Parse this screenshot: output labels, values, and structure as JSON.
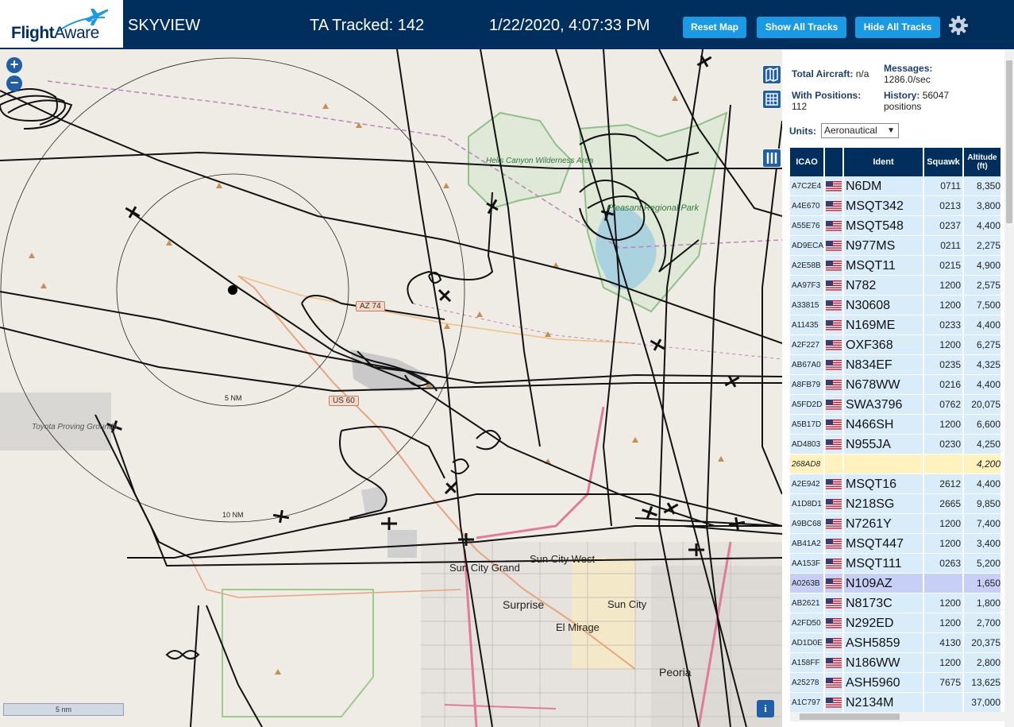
{
  "header": {
    "logo_flight": "Flight",
    "logo_aware": "Aware",
    "title": "SKYVIEW",
    "tracked": "TA Tracked: 142",
    "datetime": "1/22/2020, 4:07:33 PM",
    "reset_label": "Reset Map",
    "show_label": "Show All Tracks",
    "hide_label": "Hide All Tracks",
    "settings_icon": "gear-icon"
  },
  "colors": {
    "header_bg": "#002f5d",
    "button_bg": "#1b9ae4",
    "row_bg": "#d9ecf9",
    "row_selected": "#c8cff5",
    "row_yellow": "#fff2bf",
    "track": "#111111"
  },
  "map": {
    "zoom_in": "+",
    "zoom_out": "−",
    "ring_inner_label": "5 NM",
    "ring_outer_label": "10 NM",
    "scale_label": "5 nm",
    "info_label": "i",
    "labels": {
      "hells_canyon": "Hells Canyon Wilderness Area",
      "pleasant": "Pleasant Regional Park",
      "toyota": "Toyota Proving Grounds",
      "az74": "AZ 74",
      "us60": "US 60",
      "sun_city_grand": "Sun City Grand",
      "sun_city_west": "Sun City West",
      "surprise": "Surprise",
      "sun_city": "Sun City",
      "el_mirage": "El Mirage",
      "peoria": "Peoria"
    }
  },
  "sidebar": {
    "total_label": "Total Aircraft:",
    "total_value": "n/a",
    "messages_label": "Messages:",
    "messages_value": "1286.0/sec",
    "positions_label": "With Positions:",
    "positions_value": "112",
    "history_label": "History:",
    "history_value": "56047",
    "history_unit": "positions",
    "units_label": "Units:",
    "units_value": "Aeronautical"
  },
  "table": {
    "headers": {
      "icao": "ICAO",
      "ident": "Ident",
      "squawk": "Squawk",
      "altitude": "Altitude (ft)"
    },
    "rows": [
      {
        "icao": "A7C2E4",
        "ident": "N6DM",
        "squawk": "0711",
        "alt": "8,350"
      },
      {
        "icao": "A4E670",
        "ident": "MSQT342",
        "squawk": "0213",
        "alt": "3,800"
      },
      {
        "icao": "A55E76",
        "ident": "MSQT548",
        "squawk": "0237",
        "alt": "4,400"
      },
      {
        "icao": "AD9ECA",
        "ident": "N977MS",
        "squawk": "0211",
        "alt": "2,275"
      },
      {
        "icao": "A2E58B",
        "ident": "MSQT11",
        "squawk": "0215",
        "alt": "4,900"
      },
      {
        "icao": "AA97F3",
        "ident": "N782",
        "squawk": "1200",
        "alt": "2,575"
      },
      {
        "icao": "A33815",
        "ident": "N30608",
        "squawk": "1200",
        "alt": "7,500"
      },
      {
        "icao": "A11435",
        "ident": "N169ME",
        "squawk": "0233",
        "alt": "4,400"
      },
      {
        "icao": "A2F227",
        "ident": "OXF368",
        "squawk": "1200",
        "alt": "6,275"
      },
      {
        "icao": "AB67A0",
        "ident": "N834EF",
        "squawk": "0235",
        "alt": "4,325"
      },
      {
        "icao": "A8FB79",
        "ident": "N678WW",
        "squawk": "0216",
        "alt": "4,400"
      },
      {
        "icao": "A5FD2D",
        "ident": "SWA3796",
        "squawk": "0762",
        "alt": "20,075"
      },
      {
        "icao": "A5B17D",
        "ident": "N466SH",
        "squawk": "1200",
        "alt": "6,600"
      },
      {
        "icao": "AD4803",
        "ident": "N955JA",
        "squawk": "0230",
        "alt": "4,250"
      },
      {
        "icao": "268AD8",
        "ident": "",
        "squawk": "",
        "alt": "4,200",
        "style": "yellow"
      },
      {
        "icao": "A2E942",
        "ident": "MSQT16",
        "squawk": "2612",
        "alt": "4,400"
      },
      {
        "icao": "A1D8D1",
        "ident": "N218SG",
        "squawk": "2665",
        "alt": "9,850"
      },
      {
        "icao": "A9BC68",
        "ident": "N7261Y",
        "squawk": "1200",
        "alt": "7,400"
      },
      {
        "icao": "AB41A2",
        "ident": "MSQT447",
        "squawk": "1200",
        "alt": "3,400"
      },
      {
        "icao": "AA153F",
        "ident": "MSQT111",
        "squawk": "0263",
        "alt": "5,200"
      },
      {
        "icao": "A0263B",
        "ident": "N109AZ",
        "squawk": "",
        "alt": "1,650",
        "style": "selected"
      },
      {
        "icao": "AB2621",
        "ident": "N8173C",
        "squawk": "1200",
        "alt": "1,800"
      },
      {
        "icao": "A2FD50",
        "ident": "N292ED",
        "squawk": "1200",
        "alt": "2,700"
      },
      {
        "icao": "AD1D0E",
        "ident": "ASH5859",
        "squawk": "4130",
        "alt": "20,375"
      },
      {
        "icao": "A158FF",
        "ident": "N186WW",
        "squawk": "1200",
        "alt": "2,800"
      },
      {
        "icao": "A25278",
        "ident": "ASH5960",
        "squawk": "7675",
        "alt": "13,625"
      },
      {
        "icao": "A1C797",
        "ident": "N2134M",
        "squawk": "",
        "alt": "37,000"
      }
    ]
  }
}
